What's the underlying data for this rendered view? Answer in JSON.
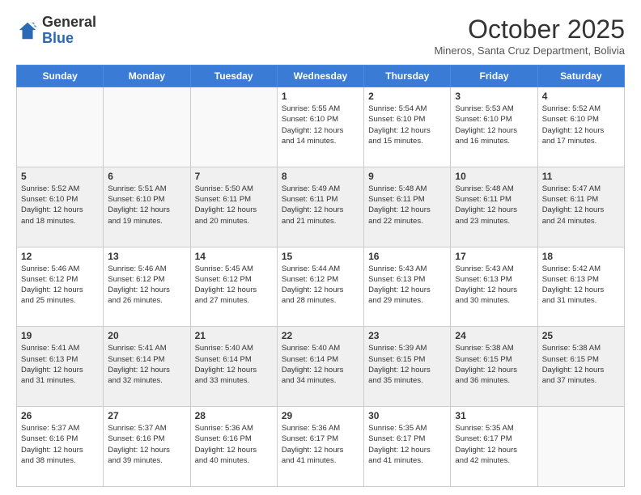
{
  "header": {
    "logo_general": "General",
    "logo_blue": "Blue",
    "month_title": "October 2025",
    "subtitle": "Mineros, Santa Cruz Department, Bolivia"
  },
  "days_of_week": [
    "Sunday",
    "Monday",
    "Tuesday",
    "Wednesday",
    "Thursday",
    "Friday",
    "Saturday"
  ],
  "weeks": [
    {
      "shaded": false,
      "days": [
        {
          "num": "",
          "info": ""
        },
        {
          "num": "",
          "info": ""
        },
        {
          "num": "",
          "info": ""
        },
        {
          "num": "1",
          "info": "Sunrise: 5:55 AM\nSunset: 6:10 PM\nDaylight: 12 hours\nand 14 minutes."
        },
        {
          "num": "2",
          "info": "Sunrise: 5:54 AM\nSunset: 6:10 PM\nDaylight: 12 hours\nand 15 minutes."
        },
        {
          "num": "3",
          "info": "Sunrise: 5:53 AM\nSunset: 6:10 PM\nDaylight: 12 hours\nand 16 minutes."
        },
        {
          "num": "4",
          "info": "Sunrise: 5:52 AM\nSunset: 6:10 PM\nDaylight: 12 hours\nand 17 minutes."
        }
      ]
    },
    {
      "shaded": true,
      "days": [
        {
          "num": "5",
          "info": "Sunrise: 5:52 AM\nSunset: 6:10 PM\nDaylight: 12 hours\nand 18 minutes."
        },
        {
          "num": "6",
          "info": "Sunrise: 5:51 AM\nSunset: 6:10 PM\nDaylight: 12 hours\nand 19 minutes."
        },
        {
          "num": "7",
          "info": "Sunrise: 5:50 AM\nSunset: 6:11 PM\nDaylight: 12 hours\nand 20 minutes."
        },
        {
          "num": "8",
          "info": "Sunrise: 5:49 AM\nSunset: 6:11 PM\nDaylight: 12 hours\nand 21 minutes."
        },
        {
          "num": "9",
          "info": "Sunrise: 5:48 AM\nSunset: 6:11 PM\nDaylight: 12 hours\nand 22 minutes."
        },
        {
          "num": "10",
          "info": "Sunrise: 5:48 AM\nSunset: 6:11 PM\nDaylight: 12 hours\nand 23 minutes."
        },
        {
          "num": "11",
          "info": "Sunrise: 5:47 AM\nSunset: 6:11 PM\nDaylight: 12 hours\nand 24 minutes."
        }
      ]
    },
    {
      "shaded": false,
      "days": [
        {
          "num": "12",
          "info": "Sunrise: 5:46 AM\nSunset: 6:12 PM\nDaylight: 12 hours\nand 25 minutes."
        },
        {
          "num": "13",
          "info": "Sunrise: 5:46 AM\nSunset: 6:12 PM\nDaylight: 12 hours\nand 26 minutes."
        },
        {
          "num": "14",
          "info": "Sunrise: 5:45 AM\nSunset: 6:12 PM\nDaylight: 12 hours\nand 27 minutes."
        },
        {
          "num": "15",
          "info": "Sunrise: 5:44 AM\nSunset: 6:12 PM\nDaylight: 12 hours\nand 28 minutes."
        },
        {
          "num": "16",
          "info": "Sunrise: 5:43 AM\nSunset: 6:13 PM\nDaylight: 12 hours\nand 29 minutes."
        },
        {
          "num": "17",
          "info": "Sunrise: 5:43 AM\nSunset: 6:13 PM\nDaylight: 12 hours\nand 30 minutes."
        },
        {
          "num": "18",
          "info": "Sunrise: 5:42 AM\nSunset: 6:13 PM\nDaylight: 12 hours\nand 31 minutes."
        }
      ]
    },
    {
      "shaded": true,
      "days": [
        {
          "num": "19",
          "info": "Sunrise: 5:41 AM\nSunset: 6:13 PM\nDaylight: 12 hours\nand 31 minutes."
        },
        {
          "num": "20",
          "info": "Sunrise: 5:41 AM\nSunset: 6:14 PM\nDaylight: 12 hours\nand 32 minutes."
        },
        {
          "num": "21",
          "info": "Sunrise: 5:40 AM\nSunset: 6:14 PM\nDaylight: 12 hours\nand 33 minutes."
        },
        {
          "num": "22",
          "info": "Sunrise: 5:40 AM\nSunset: 6:14 PM\nDaylight: 12 hours\nand 34 minutes."
        },
        {
          "num": "23",
          "info": "Sunrise: 5:39 AM\nSunset: 6:15 PM\nDaylight: 12 hours\nand 35 minutes."
        },
        {
          "num": "24",
          "info": "Sunrise: 5:38 AM\nSunset: 6:15 PM\nDaylight: 12 hours\nand 36 minutes."
        },
        {
          "num": "25",
          "info": "Sunrise: 5:38 AM\nSunset: 6:15 PM\nDaylight: 12 hours\nand 37 minutes."
        }
      ]
    },
    {
      "shaded": false,
      "days": [
        {
          "num": "26",
          "info": "Sunrise: 5:37 AM\nSunset: 6:16 PM\nDaylight: 12 hours\nand 38 minutes."
        },
        {
          "num": "27",
          "info": "Sunrise: 5:37 AM\nSunset: 6:16 PM\nDaylight: 12 hours\nand 39 minutes."
        },
        {
          "num": "28",
          "info": "Sunrise: 5:36 AM\nSunset: 6:16 PM\nDaylight: 12 hours\nand 40 minutes."
        },
        {
          "num": "29",
          "info": "Sunrise: 5:36 AM\nSunset: 6:17 PM\nDaylight: 12 hours\nand 41 minutes."
        },
        {
          "num": "30",
          "info": "Sunrise: 5:35 AM\nSunset: 6:17 PM\nDaylight: 12 hours\nand 41 minutes."
        },
        {
          "num": "31",
          "info": "Sunrise: 5:35 AM\nSunset: 6:17 PM\nDaylight: 12 hours\nand 42 minutes."
        },
        {
          "num": "",
          "info": ""
        }
      ]
    }
  ]
}
